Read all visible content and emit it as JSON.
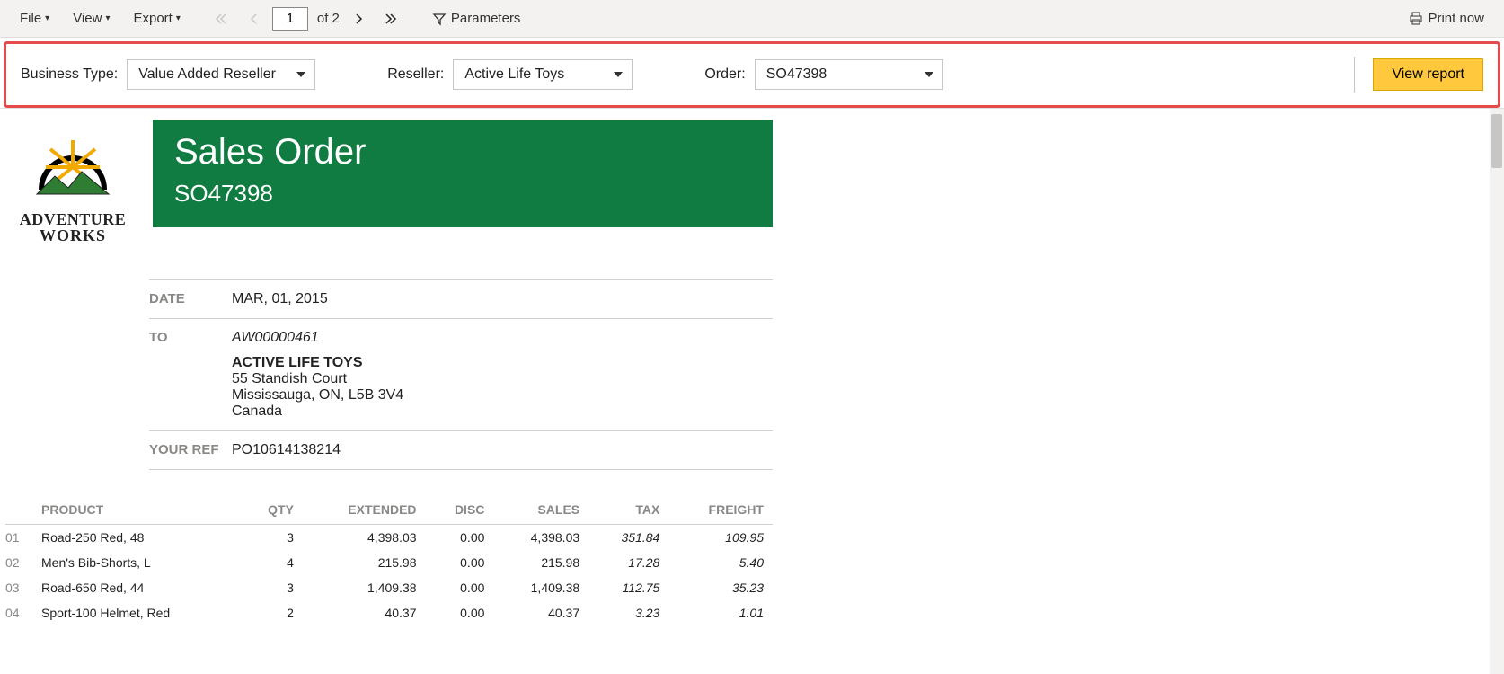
{
  "toolbar": {
    "file": "File",
    "view": "View",
    "export": "Export",
    "page_current": "1",
    "page_total": "of 2",
    "parameters": "Parameters",
    "print_now": "Print now"
  },
  "params": {
    "business_type_label": "Business Type:",
    "business_type_value": "Value Added Reseller",
    "reseller_label": "Reseller:",
    "reseller_value": "Active Life Toys",
    "order_label": "Order:",
    "order_value": "SO47398",
    "view_report": "View report"
  },
  "logo": {
    "line1": "ADVENTURE",
    "line2": "WORKS"
  },
  "banner": {
    "title": "Sales Order",
    "subtitle": "SO47398"
  },
  "meta": {
    "date_label": "DATE",
    "date_value": "MAR, 01, 2015",
    "to_label": "TO",
    "to_code": "AW00000461",
    "to_name": "ACTIVE LIFE TOYS",
    "to_addr1": "55 Standish Court",
    "to_addr2": "Mississauga, ON, L5B 3V4",
    "to_country": "Canada",
    "ref_label": "YOUR REF",
    "ref_value": "PO10614138214"
  },
  "table": {
    "headers": {
      "product": "PRODUCT",
      "qty": "QTY",
      "extended": "EXTENDED",
      "disc": "DISC",
      "sales": "SALES",
      "tax": "TAX",
      "freight": "FREIGHT"
    },
    "rows": [
      {
        "idx": "01",
        "product": "Road-250 Red, 48",
        "qty": "3",
        "extended": "4,398.03",
        "disc": "0.00",
        "sales": "4,398.03",
        "tax": "351.84",
        "freight": "109.95"
      },
      {
        "idx": "02",
        "product": "Men's Bib-Shorts, L",
        "qty": "4",
        "extended": "215.98",
        "disc": "0.00",
        "sales": "215.98",
        "tax": "17.28",
        "freight": "5.40"
      },
      {
        "idx": "03",
        "product": "Road-650 Red, 44",
        "qty": "3",
        "extended": "1,409.38",
        "disc": "0.00",
        "sales": "1,409.38",
        "tax": "112.75",
        "freight": "35.23"
      },
      {
        "idx": "04",
        "product": "Sport-100 Helmet, Red",
        "qty": "2",
        "extended": "40.37",
        "disc": "0.00",
        "sales": "40.37",
        "tax": "3.23",
        "freight": "1.01"
      }
    ]
  }
}
